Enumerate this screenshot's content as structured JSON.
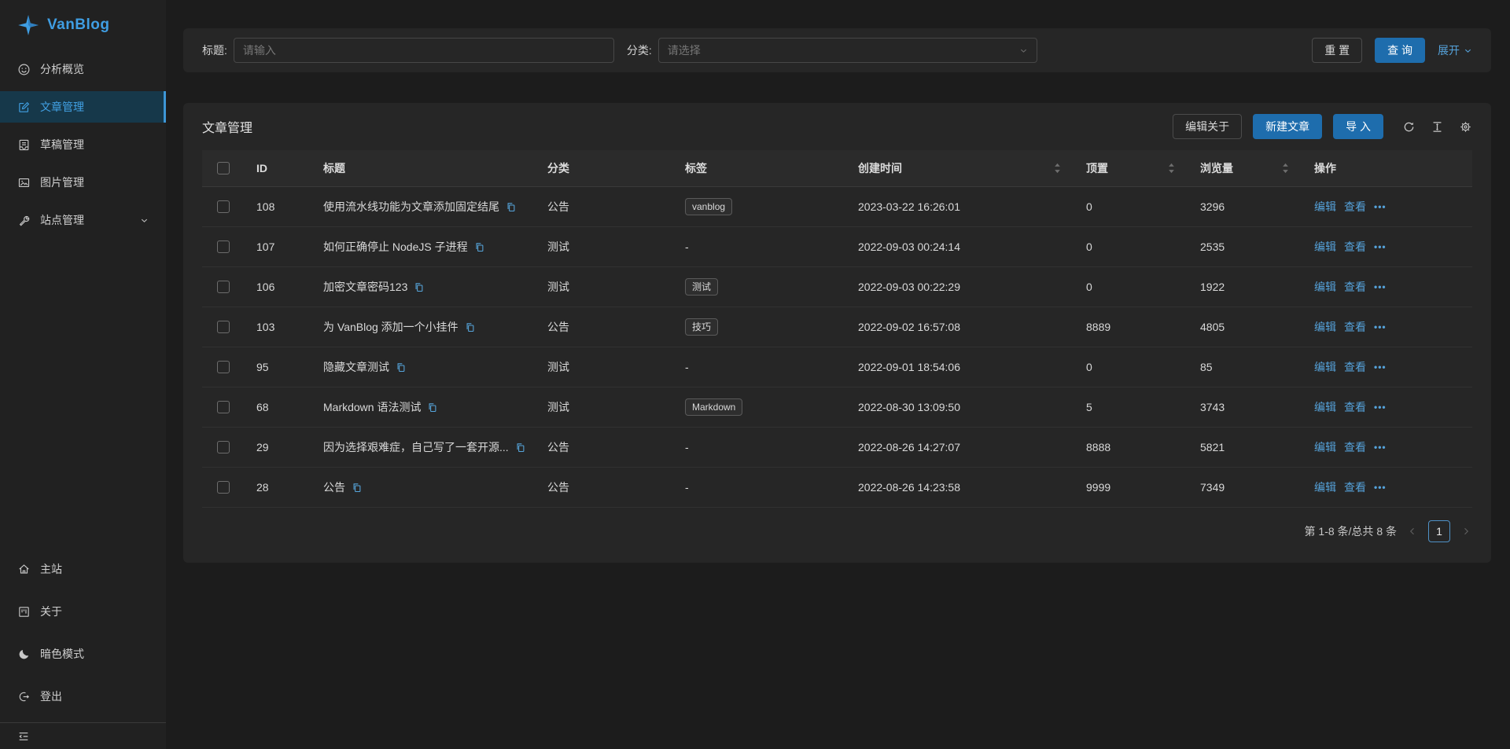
{
  "colors": {
    "primary_button": "#1e6dad",
    "link_blue": "#55a2da",
    "sidebar_active_bg": "#16384a",
    "logo_blue": "#3f9ee3",
    "card_bg": "#262626",
    "page_bg": "#1c1c1c"
  },
  "sidebar": {
    "logo_text": "VanBlog",
    "items": [
      {
        "label": "分析概览",
        "icon": "smile-icon"
      },
      {
        "label": "文章管理",
        "icon": "form-icon"
      },
      {
        "label": "草稿管理",
        "icon": "draft-icon"
      },
      {
        "label": "图片管理",
        "icon": "picture-icon"
      },
      {
        "label": "站点管理",
        "icon": "tool-icon"
      }
    ],
    "bottom_items": [
      {
        "label": "主站",
        "icon": "home-icon"
      },
      {
        "label": "关于",
        "icon": "project-icon"
      },
      {
        "label": "暗色模式",
        "icon": "moon-icon"
      },
      {
        "label": "登出",
        "icon": "logout-icon"
      }
    ]
  },
  "filter": {
    "title_label": "标题:",
    "title_placeholder": "请输入",
    "category_label": "分类:",
    "category_placeholder": "请选择",
    "reset": "重 置",
    "query": "查 询",
    "expand": "展开"
  },
  "toolbar": {
    "card_title": "文章管理",
    "edit_about": "编辑关于",
    "new_article": "新建文章",
    "import": "导 入"
  },
  "table": {
    "columns": {
      "id": "ID",
      "title": "标题",
      "category": "分类",
      "tag": "标签",
      "created": "创建时间",
      "top": "顶置",
      "views": "浏览量",
      "actions": "操作"
    },
    "actions": {
      "edit": "编辑",
      "view": "查看",
      "more": "•••"
    },
    "rows": [
      {
        "id": "108",
        "title": "使用流水线功能为文章添加固定结尾",
        "category": "公告",
        "tag": "vanblog",
        "created": "2023-03-22 16:26:01",
        "top": "0",
        "views": "3296"
      },
      {
        "id": "107",
        "title": "如何正确停止 NodeJS 子进程",
        "category": "测试",
        "tag": "-",
        "created": "2022-09-03 00:24:14",
        "top": "0",
        "views": "2535"
      },
      {
        "id": "106",
        "title": "加密文章密码123",
        "category": "测试",
        "tag": "测试",
        "created": "2022-09-03 00:22:29",
        "top": "0",
        "views": "1922"
      },
      {
        "id": "103",
        "title": "为 VanBlog 添加一个小挂件",
        "category": "公告",
        "tag": "技巧",
        "created": "2022-09-02 16:57:08",
        "top": "8889",
        "views": "4805"
      },
      {
        "id": "95",
        "title": "隐藏文章测试",
        "category": "测试",
        "tag": "-",
        "created": "2022-09-01 18:54:06",
        "top": "0",
        "views": "85"
      },
      {
        "id": "68",
        "title": "Markdown 语法测试",
        "category": "测试",
        "tag": "Markdown",
        "created": "2022-08-30 13:09:50",
        "top": "5",
        "views": "3743"
      },
      {
        "id": "29",
        "title": "因为选择艰难症，自己写了一套开源...",
        "category": "公告",
        "tag": "-",
        "created": "2022-08-26 14:27:07",
        "top": "8888",
        "views": "5821"
      },
      {
        "id": "28",
        "title": "公告",
        "category": "公告",
        "tag": "-",
        "created": "2022-08-26 14:23:58",
        "top": "9999",
        "views": "7349"
      }
    ]
  },
  "pagination": {
    "summary": "第 1-8 条/总共 8 条",
    "page": "1"
  }
}
